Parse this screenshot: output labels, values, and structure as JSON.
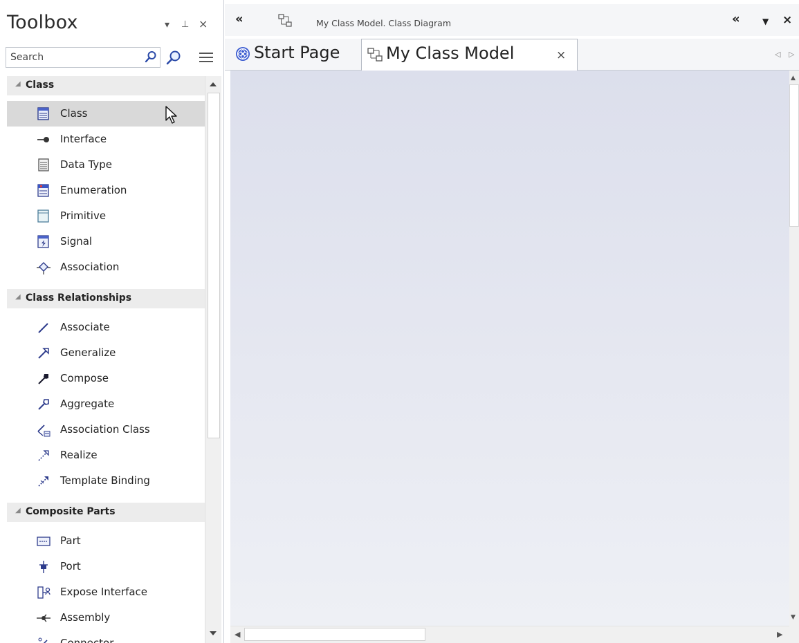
{
  "toolbox": {
    "title": "Toolbox",
    "dropdown_glyph": "▾",
    "pin_glyph": "⊥",
    "close_glyph": "×",
    "search": {
      "placeholder": "Search"
    },
    "groups": [
      {
        "label": "Class",
        "items": [
          {
            "label": "Class",
            "icon": "class-icon",
            "selected": true
          },
          {
            "label": "Interface",
            "icon": "interface-icon"
          },
          {
            "label": "Data Type",
            "icon": "data-type-icon"
          },
          {
            "label": "Enumeration",
            "icon": "enumeration-icon"
          },
          {
            "label": "Primitive",
            "icon": "primitive-icon"
          },
          {
            "label": "Signal",
            "icon": "signal-icon"
          },
          {
            "label": "Association",
            "icon": "association-icon"
          }
        ]
      },
      {
        "label": "Class Relationships",
        "items": [
          {
            "label": "Associate",
            "icon": "associate-icon"
          },
          {
            "label": "Generalize",
            "icon": "generalize-icon"
          },
          {
            "label": "Compose",
            "icon": "compose-icon"
          },
          {
            "label": "Aggregate",
            "icon": "aggregate-icon"
          },
          {
            "label": "Association Class",
            "icon": "association-class-icon"
          },
          {
            "label": "Realize",
            "icon": "realize-icon"
          },
          {
            "label": "Template Binding",
            "icon": "template-binding-icon"
          }
        ]
      },
      {
        "label": "Composite Parts",
        "items": [
          {
            "label": "Part",
            "icon": "part-icon"
          },
          {
            "label": "Port",
            "icon": "port-icon"
          },
          {
            "label": "Expose Interface",
            "icon": "expose-interface-icon"
          },
          {
            "label": "Assembly",
            "icon": "assembly-icon"
          },
          {
            "label": "Connector",
            "icon": "connector-icon"
          }
        ]
      }
    ]
  },
  "diagram": {
    "collapse_glyph": "«",
    "expand_glyph": "«",
    "menu_glyph": "▼",
    "close_glyph": "×",
    "path": "My Class Model.  Class Diagram",
    "tabs": [
      {
        "label": "Start Page",
        "icon": "start-page-icon",
        "active": false
      },
      {
        "label": "My Class Model",
        "icon": "class-diagram-icon",
        "active": true
      }
    ],
    "tab_close_glyph": "×",
    "tab_scroll_left_glyph": "◁",
    "tab_scroll_right_glyph": "▷",
    "canvas_gradient": [
      "#dcdfec",
      "#eef0f5"
    ]
  },
  "colors": {
    "accent": "#2e3c8c",
    "selected_row": "#d9d9d9",
    "group_header_bg": "#ececec"
  }
}
